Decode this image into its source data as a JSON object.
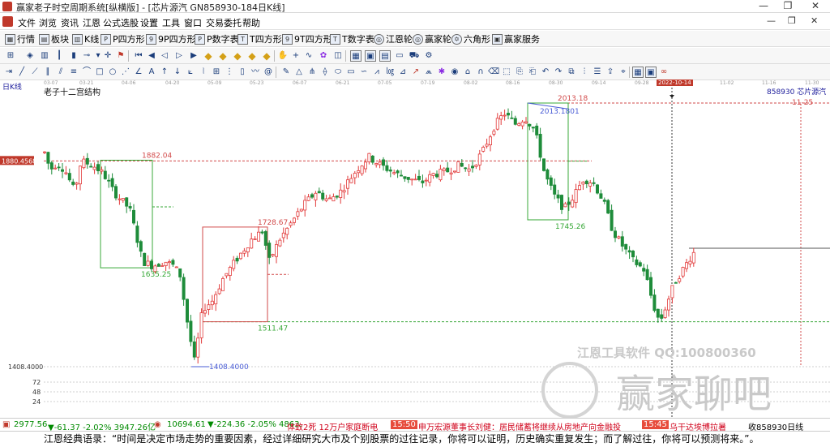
{
  "window": {
    "title": "赢家老子时空周期系统[纵横版] - [芯片源汽  GN858930-184日K线]",
    "controls": [
      "—",
      "❐",
      "✕"
    ]
  },
  "menu": {
    "items": [
      "文件",
      "浏览",
      "资讯",
      "江恩",
      "公式选股",
      "设置",
      "工具",
      "窗口",
      "交易委托",
      "帮助"
    ],
    "right_controls": [
      "—",
      "❐",
      "✕"
    ]
  },
  "toolbar1": {
    "items": [
      {
        "icon": "grid-icon",
        "label": "行情"
      },
      {
        "icon": "blocks-icon",
        "label": "板块"
      },
      {
        "icon": "candle-icon",
        "label": "K线"
      },
      {
        "icon": "p-icon",
        "label": "P四方形"
      },
      {
        "icon": "p9-icon",
        "label": "9P四方形"
      },
      {
        "icon": "p-icon",
        "label": "P数字表"
      },
      {
        "icon": "t-icon",
        "label": "T四方形"
      },
      {
        "icon": "t9-icon",
        "label": "9T四方形"
      },
      {
        "icon": "tn-icon",
        "label": "T数字表"
      },
      {
        "icon": "wheel-icon",
        "label": "江恩轮"
      },
      {
        "icon": "wheel-icon",
        "label": "赢家轮"
      },
      {
        "icon": "star-icon",
        "label": "六角形"
      },
      {
        "icon": "service-icon",
        "label": "赢家服务"
      }
    ]
  },
  "datebar": {
    "dates": [
      "03-07",
      "03-21",
      "04-06",
      "04-20",
      "05-09",
      "05-23",
      "06-07",
      "06-21",
      "07-05",
      "07-19",
      "08-02",
      "08-16",
      "08-30",
      "09-14",
      "09-28",
      "2022-10-14",
      "11-02",
      "11-16",
      "11-30"
    ],
    "highlight": "2022-10-14"
  },
  "chart": {
    "period_label": "日K线",
    "study_label": "老子十二宫结构",
    "symbol_label": "858930  芯片源汽",
    "left_price_tag": "1880.4568",
    "cursor_date_tag": "11-25",
    "price_annotations": [
      "1882.04",
      "1635.25",
      "1728.67",
      "1511.47",
      "1408.4000",
      "2013.18",
      "2013.1801",
      "1745.26"
    ],
    "y_axis_labels": [
      "1408.4000",
      "72",
      "48",
      "24"
    ],
    "colors": {
      "up": "#e23a3a",
      "down": "#1e8c3a",
      "dash_red": "#d24a4a",
      "dash_green": "#38a838",
      "line_blue": "#4a5dd6"
    }
  },
  "chart_data": {
    "type": "candlestick",
    "title": "",
    "x": [
      "03-07",
      "03-21",
      "04-06",
      "04-20",
      "05-09",
      "05-23",
      "06-07",
      "06-21",
      "07-05",
      "07-19",
      "08-02",
      "08-16",
      "08-30",
      "09-14",
      "09-28",
      "2022-10-14",
      "11-02",
      "11-16",
      "11-30"
    ],
    "y_annotations": [
      1882.04,
      1635.25,
      1728.67,
      1511.47,
      1408.4,
      2013.18,
      1745.26
    ]
  },
  "watermarks": {
    "software": "江恩工具软件  QQ:100800360",
    "brand": "赢家聊吧"
  },
  "status": {
    "idx1_value": "2977.56",
    "idx1_change": "▼-61.37 -2.02% 3947.26亿",
    "idx2_value": "10694.61",
    "idx2_change": "▼-224.36 -2.05% 4863.",
    "news1": "体致2死 12万户家庭断电",
    "time1": "15:50",
    "news2": "申万宏源董事长刘健：居民储蓄将继续从房地产向金融投",
    "time2": "15:45",
    "news3": "乌干达埃博拉暑",
    "right": "收858930日线"
  },
  "quote": "江恩经典语录：“时间是决定市场走势的重要因素，经过详细研究大市及个别股票的过往记录，你将可以证明，历史确实重复发生；而了解过往，你将可以预测将来。”。"
}
